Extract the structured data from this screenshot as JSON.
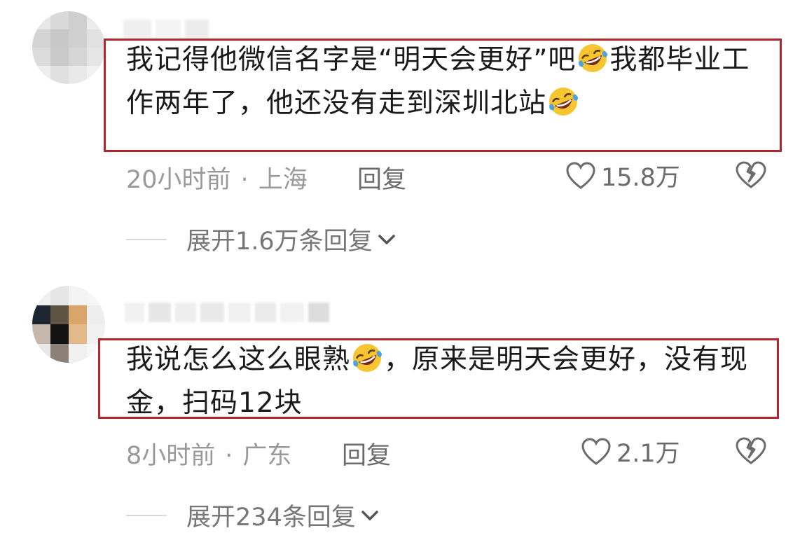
{
  "comments": [
    {
      "text_a": "我记得他微信名字是“明天会更好”吧",
      "text_b": "我都毕业工作两年了，他还没有走到深圳北站",
      "emoji_1": "rofl-emoji",
      "emoji_2": "rofl-emoji",
      "time": "20小时前",
      "separator": "·",
      "location": "上海",
      "reply_label": "回复",
      "likes": "15.8万",
      "expand_label": "展开1.6万条回复"
    },
    {
      "text_a": "我说怎么这么眼熟",
      "text_b": "，原来是明天会更好，没有现金，扫码12块",
      "emoji_1": "rofl-emoji",
      "time": "8小时前",
      "separator": "·",
      "location": "广东",
      "reply_label": "回复",
      "likes": "2.1万",
      "expand_label": "展开234条回复"
    }
  ],
  "colors": {
    "highlight_border": "#b0262a",
    "text": "#1a1a1a",
    "meta": "#999999",
    "action": "#6b6b6b"
  },
  "icons": {
    "like": "heart-outline-icon",
    "dislike": "broken-heart-icon",
    "expand": "chevron-down-icon"
  }
}
